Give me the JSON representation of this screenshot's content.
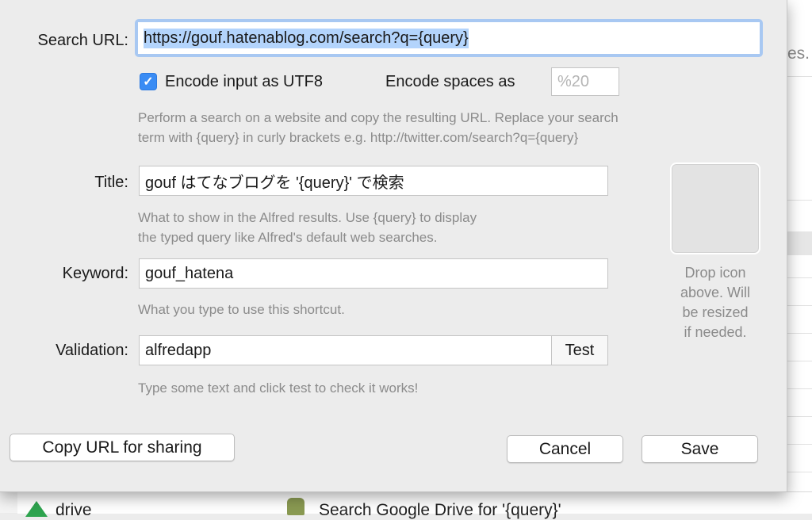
{
  "background": {
    "peek_text": "es.",
    "list_item_1": "drive",
    "list_item_2": "Search Google Drive for '{query}'"
  },
  "form": {
    "search_url": {
      "label": "Search URL:",
      "value": "https://gouf.hatenablog.com/search?q={query}"
    },
    "encode_utf8": {
      "label": "Encode input as UTF8",
      "checked": true
    },
    "encode_spaces": {
      "label": "Encode spaces as",
      "placeholder": "%20"
    },
    "search_help": [
      "Perform a search on a website and copy the resulting URL. Replace your search",
      "term with {query} in curly brackets e.g. http://twitter.com/search?q={query}"
    ],
    "title": {
      "label": "Title:",
      "value": "gouf はてなブログを '{query}' で検索",
      "help": [
        "What to show in the Alfred results. Use {query} to display",
        "the typed query like Alfred's default web searches."
      ]
    },
    "keyword": {
      "label": "Keyword:",
      "value": "gouf_hatena",
      "help": "What you type to use this shortcut."
    },
    "validation": {
      "label": "Validation:",
      "value": "alfredapp",
      "test_label": "Test",
      "help": "Type some text and click test to check it works!"
    },
    "icon_drop": {
      "caption_lines": [
        "Drop icon",
        "above. Will",
        "be resized",
        "if needed."
      ]
    }
  },
  "buttons": {
    "copy_url": "Copy URL for sharing",
    "cancel": "Cancel",
    "save": "Save"
  },
  "colors": {
    "accent": "#3a8cf4",
    "focus_ring": "#a8c8f2",
    "selection": "#b3d4fc",
    "help_text": "#8b8b8b"
  }
}
